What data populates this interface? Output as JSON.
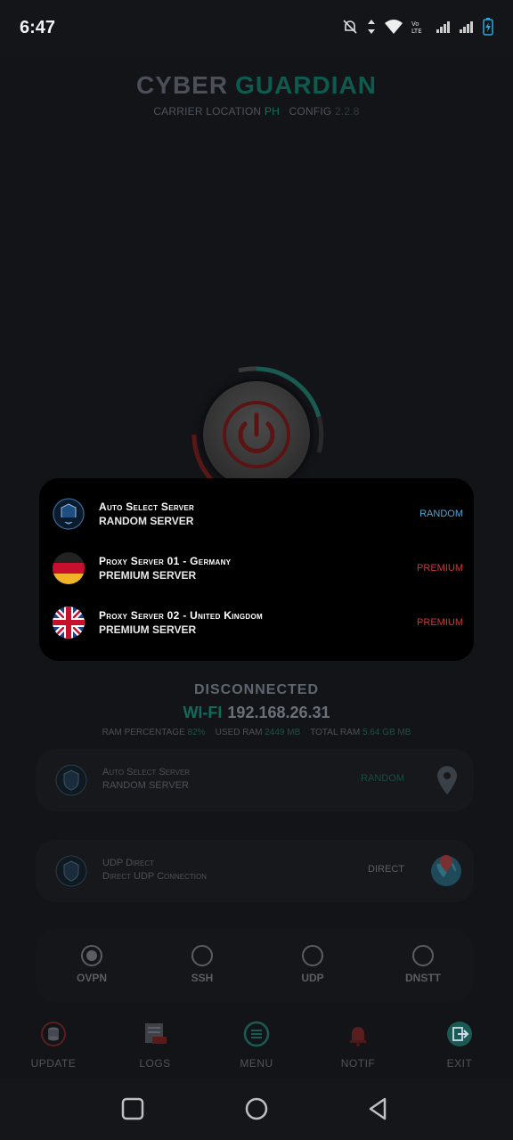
{
  "status_bar": {
    "time": "6:47"
  },
  "header": {
    "title_part1": "CYBER",
    "title_part2": "GUARDIAN",
    "carrier_label": "CARRIER LOCATION",
    "carrier_value": "PH",
    "config_label": "CONFIG",
    "config_value": "2.2.8"
  },
  "dropdown": {
    "items": [
      {
        "title": "Auto Select Server",
        "subtitle": "RANDOM SERVER",
        "tag": "RANDOM",
        "icon": "cyber-guardian-logo"
      },
      {
        "title": "Proxy Server 01 - Germany",
        "subtitle": "PREMIUM SERVER",
        "tag": "PREMIUM",
        "icon": "germany-flag"
      },
      {
        "title": "Proxy Server 02 - United Kingdom",
        "subtitle": "PREMIUM SERVER",
        "tag": "PREMIUM",
        "icon": "uk-flag"
      }
    ]
  },
  "connection": {
    "state": "DISCONNECTED",
    "network": "WI-FI",
    "ip": "192.168.26.31",
    "ram_percentage_label": "RAM PERCENTAGE",
    "ram_percentage_value": "82%",
    "used_ram_label": "USED RAM",
    "used_ram_value": "2449 MB",
    "total_ram_label": "TOTAL RAM",
    "total_ram_value": "5.64 GB MB"
  },
  "server_card": {
    "title": "Auto Select Server",
    "subtitle": "RANDOM SERVER",
    "tag": "RANDOM",
    "icon": "location-pin-icon"
  },
  "payload_card": {
    "title": "UDP Direct",
    "subtitle": "Direct UDP Connection",
    "tag": "DIRECT",
    "icon": "globe-icon"
  },
  "protocols": [
    {
      "label": "OVPN",
      "selected": true
    },
    {
      "label": "SSH",
      "selected": false
    },
    {
      "label": "UDP",
      "selected": false
    },
    {
      "label": "DNSTT",
      "selected": false
    }
  ],
  "bottom_nav": [
    {
      "label": "UPDATE",
      "icon": "database-icon"
    },
    {
      "label": "LOGS",
      "icon": "logs-icon"
    },
    {
      "label": "MENU",
      "icon": "menu-icon"
    },
    {
      "label": "NOTIF",
      "icon": "bell-icon"
    },
    {
      "label": "EXIT",
      "icon": "exit-icon"
    }
  ],
  "colors": {
    "accent": "#0f6b5b",
    "power_red": "#c62828",
    "random_blue": "#4da6d9",
    "premium_red": "#c23b3b"
  }
}
